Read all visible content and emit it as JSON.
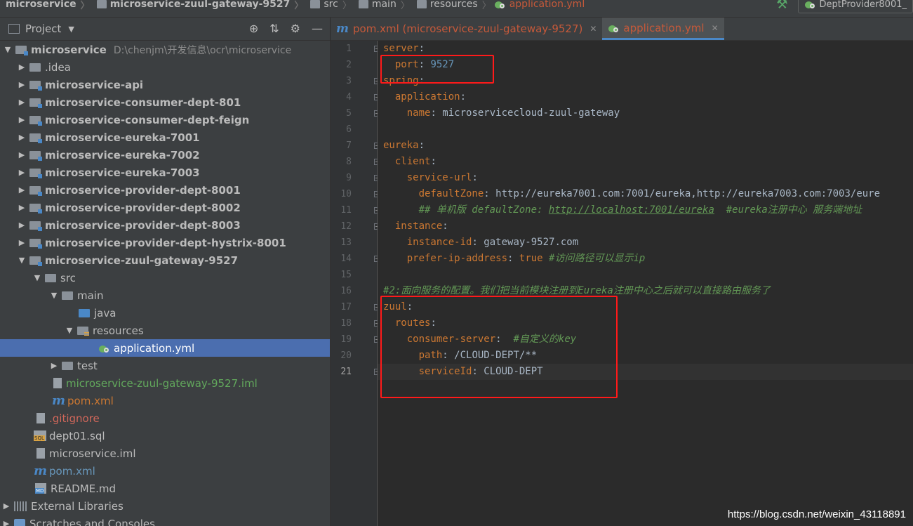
{
  "breadcrumb": {
    "items": [
      "microservice",
      "microservice-zuul-gateway-9527",
      "src",
      "main",
      "resources",
      "application.yml"
    ],
    "run_config": "DeptProvider8001_"
  },
  "project_panel": {
    "title": "Project",
    "tree": [
      {
        "label": "microservice",
        "path": "D:\\chenjm\\开发信息\\ocr\\microservice"
      },
      {
        "label": ".idea"
      },
      {
        "label": "microservice-api"
      },
      {
        "label": "microservice-consumer-dept-801"
      },
      {
        "label": "microservice-consumer-dept-feign"
      },
      {
        "label": "microservice-eureka-7001"
      },
      {
        "label": "microservice-eureka-7002"
      },
      {
        "label": "microservice-eureka-7003"
      },
      {
        "label": "microservice-provider-dept-8001"
      },
      {
        "label": "microservice-provider-dept-8002"
      },
      {
        "label": "microservice-provider-dept-8003"
      },
      {
        "label": "microservice-provider-dept-hystrix-8001"
      },
      {
        "label": "microservice-zuul-gateway-9527"
      },
      {
        "label": "src"
      },
      {
        "label": "main"
      },
      {
        "label": "java"
      },
      {
        "label": "resources"
      },
      {
        "label": "application.yml"
      },
      {
        "label": "test"
      },
      {
        "label": "microservice-zuul-gateway-9527.iml"
      },
      {
        "label": "pom.xml"
      },
      {
        "label": ".gitignore"
      },
      {
        "label": "dept01.sql"
      },
      {
        "label": "microservice.iml"
      },
      {
        "label": "pom.xml"
      },
      {
        "label": "README.md"
      },
      {
        "label": "External Libraries"
      },
      {
        "label": "Scratches and Consoles"
      }
    ]
  },
  "tabs": [
    {
      "label": "pom.xml (microservice-zuul-gateway-9527)"
    },
    {
      "label": "application.yml"
    }
  ],
  "editor": {
    "current_line": 21,
    "lines": [
      {
        "no": "1",
        "text": "server:"
      },
      {
        "no": "2",
        "text": "  port: 9527"
      },
      {
        "no": "3",
        "text": "spring:"
      },
      {
        "no": "4",
        "text": "  application:"
      },
      {
        "no": "5",
        "text": "    name: microservicecloud-zuul-gateway"
      },
      {
        "no": "6",
        "text": ""
      },
      {
        "no": "7",
        "text": "eureka:"
      },
      {
        "no": "8",
        "text": "  client:"
      },
      {
        "no": "9",
        "text": "    service-url:"
      },
      {
        "no": "10",
        "text": "      defaultZone: http://eureka7001.com:7001/eureka,http://eureka7003.com:7003/eure"
      },
      {
        "no": "11",
        "text": "      ## 单机版 defaultZone: http://localhost:7001/eureka  #eureka注册中心 服务端地址"
      },
      {
        "no": "12",
        "text": "  instance:"
      },
      {
        "no": "13",
        "text": "    instance-id: gateway-9527.com"
      },
      {
        "no": "14",
        "text": "    prefer-ip-address: true #访问路径可以显示ip"
      },
      {
        "no": "15",
        "text": ""
      },
      {
        "no": "16",
        "text": "#2:面向服务的配置。我们把当前模块注册到Eureka注册中心之后就可以直接路由服务了"
      },
      {
        "no": "17",
        "text": "zuul:"
      },
      {
        "no": "18",
        "text": "  routes:"
      },
      {
        "no": "19",
        "text": "    consumer-server:  #自定义的key"
      },
      {
        "no": "20",
        "text": "      path: /CLOUD-DEPT/**"
      },
      {
        "no": "21",
        "text": "      serviceId: CLOUD-DEPT"
      }
    ]
  },
  "watermark": "https://blog.csdn.net/weixin_43118891",
  "colors": {
    "key": "#cc7832",
    "value": "#a9b7c6",
    "number": "#6897bb",
    "comment": "#629755",
    "highlight_box": "#ff1a1a",
    "selection": "#4b6eaf"
  }
}
